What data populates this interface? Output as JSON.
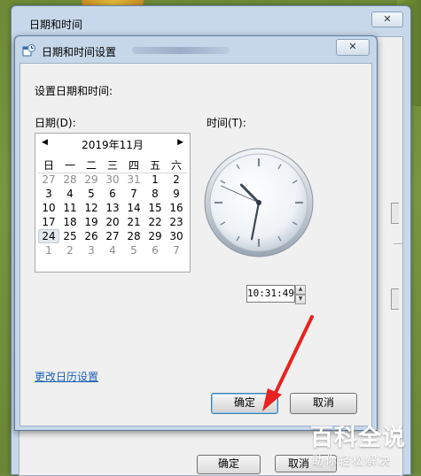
{
  "outer_dialog": {
    "title": "日期和时间",
    "close_label": "✕",
    "ok_label": "确定",
    "cancel_label": "取消"
  },
  "dialog": {
    "title": "日期和时间设置",
    "close_label": "✕",
    "heading": "设置日期和时间:",
    "date_label": "日期(D):",
    "time_label": "时间(T):",
    "change_calendar_link": "更改日历设置",
    "ok_label": "确定",
    "cancel_label": "取消"
  },
  "calendar": {
    "prev_icon": "◀",
    "next_icon": "▶",
    "month_label": "2019年11月",
    "weekdays": [
      "日",
      "一",
      "二",
      "三",
      "四",
      "五",
      "六"
    ],
    "days": [
      {
        "d": "27",
        "other": true
      },
      {
        "d": "28",
        "other": true
      },
      {
        "d": "29",
        "other": true
      },
      {
        "d": "30",
        "other": true
      },
      {
        "d": "31",
        "other": true
      },
      {
        "d": "1"
      },
      {
        "d": "2"
      },
      {
        "d": "3"
      },
      {
        "d": "4"
      },
      {
        "d": "5"
      },
      {
        "d": "6"
      },
      {
        "d": "7"
      },
      {
        "d": "8"
      },
      {
        "d": "9"
      },
      {
        "d": "10"
      },
      {
        "d": "11"
      },
      {
        "d": "12"
      },
      {
        "d": "13"
      },
      {
        "d": "14"
      },
      {
        "d": "15"
      },
      {
        "d": "16"
      },
      {
        "d": "17"
      },
      {
        "d": "18"
      },
      {
        "d": "19"
      },
      {
        "d": "20"
      },
      {
        "d": "21"
      },
      {
        "d": "22"
      },
      {
        "d": "23"
      },
      {
        "d": "24",
        "selected": true
      },
      {
        "d": "25"
      },
      {
        "d": "26"
      },
      {
        "d": "27"
      },
      {
        "d": "28"
      },
      {
        "d": "29"
      },
      {
        "d": "30"
      },
      {
        "d": "1",
        "other": true
      },
      {
        "d": "2",
        "other": true
      },
      {
        "d": "3",
        "other": true
      },
      {
        "d": "4",
        "other": true
      },
      {
        "d": "5",
        "other": true
      },
      {
        "d": "6",
        "other": true
      },
      {
        "d": "7",
        "other": true
      }
    ]
  },
  "clock": {
    "hour": 10,
    "minute": 31,
    "second": 49,
    "time_text": "10:31:49"
  },
  "watermark": {
    "title": "百科全说",
    "subtitle": "助你轻松解决"
  },
  "colors": {
    "link": "#1a5fb4",
    "annotation_arrow": "#e8231f"
  }
}
